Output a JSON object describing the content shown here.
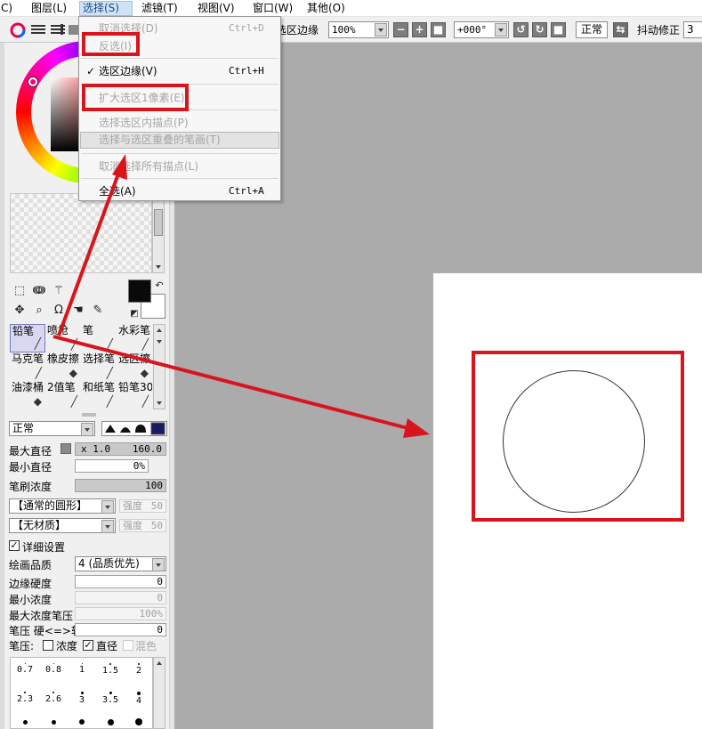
{
  "menubar": {
    "items": [
      {
        "label": "C)"
      },
      {
        "label": "图层(L)"
      },
      {
        "label": "选择(S)"
      },
      {
        "label": "滤镜(T)"
      },
      {
        "label": "视图(V)"
      },
      {
        "label": "窗口(W)"
      },
      {
        "label": "其他(O)"
      }
    ]
  },
  "toolbar": {
    "selection_edge_label": "选区边缘",
    "zoom_value": "100%",
    "rotation_value": "+000°",
    "blend_mode_button": "正常",
    "stabilizer_label": "抖动修正",
    "stabilizer_value": "3"
  },
  "select_menu": {
    "items": [
      {
        "label": "取消选择(D)",
        "shortcut": "Ctrl+D",
        "enabled": false
      },
      {
        "label": "反选(I)",
        "shortcut": "",
        "enabled": false
      },
      {
        "label": "选区边缘(V)",
        "shortcut": "Ctrl+H",
        "enabled": true,
        "checked": true
      },
      {
        "label": "扩大选区1像素(E)",
        "shortcut": "",
        "enabled": false
      },
      {
        "label": "选择选区内描点(P)",
        "shortcut": "",
        "enabled": false
      },
      {
        "label": "选择与选区重叠的笔画(T)",
        "shortcut": "",
        "enabled": false
      },
      {
        "label": "取消选择所有描点(L)",
        "shortcut": "",
        "enabled": false
      },
      {
        "label": "全选(A)",
        "shortcut": "Ctrl+A",
        "enabled": true
      }
    ]
  },
  "brushes": [
    {
      "label": "铅笔"
    },
    {
      "label": "喷枪"
    },
    {
      "label": "笔"
    },
    {
      "label": "水彩笔"
    },
    {
      "label": "马克笔"
    },
    {
      "label": "橡皮擦"
    },
    {
      "label": "选择笔"
    },
    {
      "label": "选区擦"
    },
    {
      "label": "油漆桶"
    },
    {
      "label": "2值笔"
    },
    {
      "label": "和纸笔"
    },
    {
      "label": "铅笔30"
    }
  ],
  "brush_props": {
    "blend_mode": "正常",
    "max_size_label": "最大直径",
    "max_size_multiplier": "x 1.0",
    "max_size_value": "160.0",
    "min_size_label": "最小直径",
    "min_size_value": "0%",
    "density_label": "笔刷浓度",
    "density_value": "100",
    "shape_select": "【通常的圆形】",
    "shape_strength_label": "强度",
    "shape_strength_value": "50",
    "texture_select": "【无材质】",
    "texture_strength_label": "强度",
    "texture_strength_value": "50",
    "advanced_label": "详细设置",
    "quality_label": "绘画品质",
    "quality_value": "4 (品质优先)",
    "edge_hardness_label": "边缘硬度",
    "edge_hardness_value": "0",
    "min_density_label": "最小浓度",
    "min_density_value": "0",
    "max_density_pressure_label": "最大浓度笔压",
    "max_density_pressure_value": "100%",
    "pressure_label": "笔压 硬<=>软",
    "pressure_value": "0",
    "pressure_prefix": "笔压:",
    "pressure_density": "浓度",
    "pressure_size": "直径",
    "pressure_blend": "混色"
  },
  "size_presets": {
    "row1": [
      "0.7",
      "0.8",
      "1",
      "1.5",
      "2"
    ],
    "row2": [
      "2.3",
      "2.6",
      "3",
      "3.5",
      "4"
    ]
  },
  "colors": {
    "highlight_red": "#d8141c",
    "foreground": "#0a0a0a",
    "background": "#ffffff",
    "workspace": "#ababab"
  }
}
